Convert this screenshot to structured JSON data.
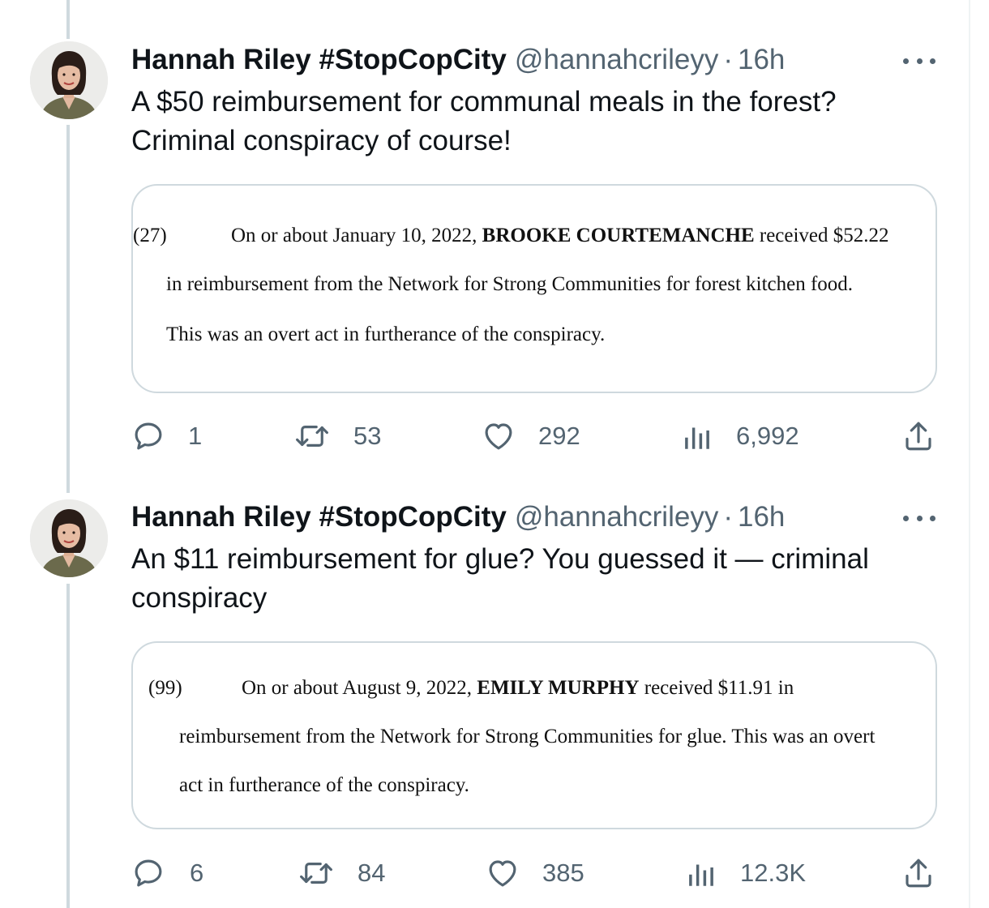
{
  "tweets": [
    {
      "author_name": "Hannah Riley #StopCopCity",
      "handle": "@hannahcrileyy",
      "separator": "·",
      "time": "16h",
      "text": "A $50 reimbursement for communal meals in the forest? Criminal conspiracy of course!",
      "document": {
        "number": "(27)",
        "line1_before": "On or about January 10, 2022, ",
        "line1_name": "BROOKE COURTEMANCHE",
        "line1_after": " received $52.22",
        "line2": "in reimbursement from the Network for Strong Communities for forest kitchen food.",
        "line3": "This was an overt act in furtherance of the conspiracy."
      },
      "replies": "1",
      "retweets": "53",
      "likes": "292",
      "views": "6,992"
    },
    {
      "author_name": "Hannah Riley #StopCopCity",
      "handle": "@hannahcrileyy",
      "separator": "·",
      "time": "16h",
      "text": "An $11 reimbursement for glue? You guessed it — criminal conspiracy",
      "document": {
        "number": "(99)",
        "line1_before": "On or about August 9, 2022, ",
        "line1_name": "EMILY MURPHY",
        "line1_after": " received $11.91 in",
        "line2": "reimbursement from the Network for Strong Communities for glue.  This was an overt",
        "line3": "act in furtherance of the conspiracy."
      },
      "replies": "6",
      "retweets": "84",
      "likes": "385",
      "views": "12.3K"
    }
  ],
  "icons": {
    "reply": "reply-icon",
    "retweet": "retweet-icon",
    "like": "heart-icon",
    "views": "views-icon",
    "share": "share-icon",
    "more": "more-icon"
  },
  "colors": {
    "text": "#0f1419",
    "secondary": "#536471",
    "border": "#cfd9de"
  }
}
